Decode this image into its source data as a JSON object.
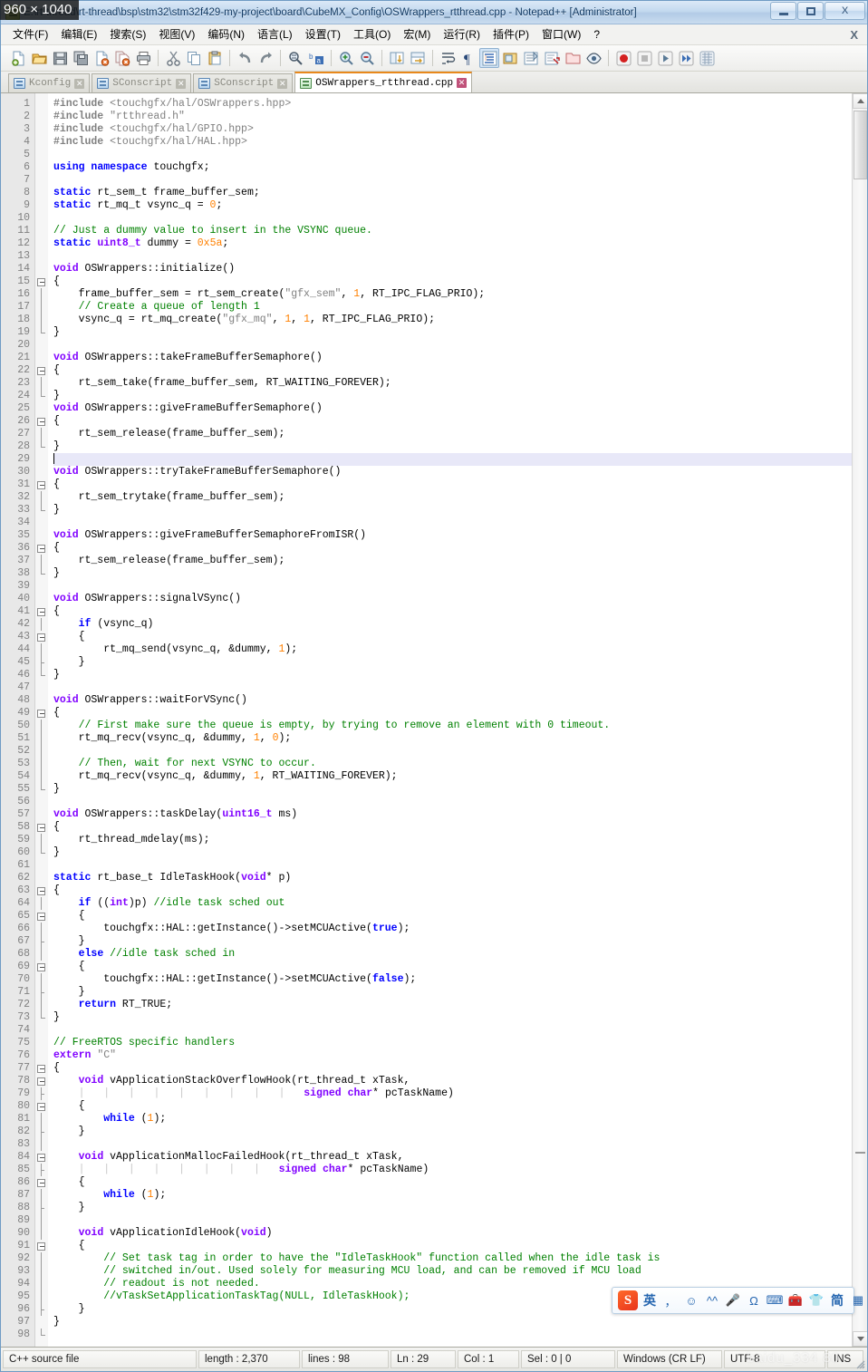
{
  "overlay": {
    "size_badge": "960 × 1040"
  },
  "window": {
    "title": "E:\\rt-thread\\rt-thread\\bsp\\stm32\\stm32f429-my-project\\board\\CubeMX_Config\\OSWrappers_rtthread.cpp - Notepad++ [Administrator]",
    "minimize_label": "Minimize",
    "maximize_label": "Restore",
    "close_label": "X",
    "doc_close_label": "X"
  },
  "menu": {
    "items": [
      "文件(F)",
      "编辑(E)",
      "搜索(S)",
      "视图(V)",
      "编码(N)",
      "语言(L)",
      "设置(T)",
      "工具(O)",
      "宏(M)",
      "运行(R)",
      "插件(P)",
      "窗口(W)",
      "?"
    ]
  },
  "toolbar": {
    "buttons": [
      "new-file",
      "open-file",
      "save-file",
      "save-all",
      "close-file",
      "close-all",
      "print",
      "sep",
      "cut",
      "copy",
      "paste",
      "sep",
      "undo",
      "redo",
      "sep",
      "find",
      "replace",
      "sep",
      "zoom-in",
      "zoom-out",
      "sep",
      "sync-vertical-scroll",
      "sync-horizontal-scroll",
      "sep",
      "word-wrap",
      "show-all-characters",
      "show-indent-guide",
      "user-defined-dialog",
      "show-document-map",
      "function-list",
      "folder-as-workspace",
      "monitoring",
      "sep",
      "macro-record",
      "macro-stop",
      "macro-play",
      "macro-playback-multiple",
      "macro-save"
    ]
  },
  "tabs": [
    {
      "label": "Kconfig",
      "active": false
    },
    {
      "label": "SConscript",
      "active": false
    },
    {
      "label": "SConscript",
      "active": false
    },
    {
      "label": "OSWrappers_rtthread.cpp",
      "active": true
    }
  ],
  "editor": {
    "current_line": 29,
    "total_lines": 98,
    "lines": [
      {
        "n": 1,
        "fold": "none",
        "html": "<span class='pre'>#include</span> <span class='str'>&lt;touchgfx/hal/OSWrappers.hpp&gt;</span>"
      },
      {
        "n": 2,
        "fold": "none",
        "html": "<span class='pre'>#include</span> <span class='str'>\"rtthread.h\"</span>"
      },
      {
        "n": 3,
        "fold": "none",
        "html": "<span class='pre'>#include</span> <span class='str'>&lt;touchgfx/hal/GPIO.hpp&gt;</span>"
      },
      {
        "n": 4,
        "fold": "none",
        "html": "<span class='pre'>#include</span> <span class='str'>&lt;touchgfx/hal/HAL.hpp&gt;</span>"
      },
      {
        "n": 5,
        "fold": "none",
        "html": ""
      },
      {
        "n": 6,
        "fold": "none",
        "html": "<span class='kw'>using</span> <span class='kw'>namespace</span> touchgfx;"
      },
      {
        "n": 7,
        "fold": "none",
        "html": ""
      },
      {
        "n": 8,
        "fold": "none",
        "html": "<span class='kw'>static</span> rt_sem_t frame_buffer_sem;"
      },
      {
        "n": 9,
        "fold": "none",
        "html": "<span class='kw'>static</span> rt_mq_t vsync_q = <span class='num'>0</span>;"
      },
      {
        "n": 10,
        "fold": "none",
        "html": ""
      },
      {
        "n": 11,
        "fold": "none",
        "html": "<span class='cmt'>// Just a dummy value to insert in the VSYNC queue.</span>"
      },
      {
        "n": 12,
        "fold": "none",
        "html": "<span class='kw'>static</span> <span class='typ'>uint8_t</span> dummy = <span class='num'>0x5a</span>;"
      },
      {
        "n": 13,
        "fold": "none",
        "html": ""
      },
      {
        "n": 14,
        "fold": "none",
        "html": "<span class='typ'>void</span> OSWrappers::initialize()"
      },
      {
        "n": 15,
        "fold": "open",
        "html": "{"
      },
      {
        "n": 16,
        "fold": "line",
        "html": "    frame_buffer_sem = rt_sem_create(<span class='str'>\"gfx_sem\"</span>, <span class='num'>1</span>, RT_IPC_FLAG_PRIO);"
      },
      {
        "n": 17,
        "fold": "line",
        "html": "    <span class='cmt'>// Create a queue of length 1</span>"
      },
      {
        "n": 18,
        "fold": "line",
        "html": "    vsync_q = rt_mq_create(<span class='str'>\"gfx_mq\"</span>, <span class='num'>1</span>, <span class='num'>1</span>, RT_IPC_FLAG_PRIO);"
      },
      {
        "n": 19,
        "fold": "end",
        "html": "}"
      },
      {
        "n": 20,
        "fold": "none",
        "html": ""
      },
      {
        "n": 21,
        "fold": "none",
        "html": "<span class='typ'>void</span> OSWrappers::takeFrameBufferSemaphore()"
      },
      {
        "n": 22,
        "fold": "open",
        "html": "{"
      },
      {
        "n": 23,
        "fold": "line",
        "html": "    rt_sem_take(frame_buffer_sem, RT_WAITING_FOREVER);"
      },
      {
        "n": 24,
        "fold": "end",
        "html": "}"
      },
      {
        "n": 25,
        "fold": "none",
        "html": "<span class='typ'>void</span> OSWrappers::giveFrameBufferSemaphore()"
      },
      {
        "n": 26,
        "fold": "open",
        "html": "{"
      },
      {
        "n": 27,
        "fold": "line",
        "html": "    rt_sem_release(frame_buffer_sem);"
      },
      {
        "n": 28,
        "fold": "end",
        "html": "}"
      },
      {
        "n": 29,
        "fold": "none",
        "html": "<span class='caret'></span>",
        "current": true
      },
      {
        "n": 30,
        "fold": "none",
        "html": "<span class='typ'>void</span> OSWrappers::tryTakeFrameBufferSemaphore()"
      },
      {
        "n": 31,
        "fold": "open",
        "html": "{"
      },
      {
        "n": 32,
        "fold": "line",
        "html": "    rt_sem_trytake(frame_buffer_sem);"
      },
      {
        "n": 33,
        "fold": "end",
        "html": "}"
      },
      {
        "n": 34,
        "fold": "none",
        "html": ""
      },
      {
        "n": 35,
        "fold": "none",
        "html": "<span class='typ'>void</span> OSWrappers::giveFrameBufferSemaphoreFromISR()"
      },
      {
        "n": 36,
        "fold": "open",
        "html": "{"
      },
      {
        "n": 37,
        "fold": "line",
        "html": "    rt_sem_release(frame_buffer_sem);"
      },
      {
        "n": 38,
        "fold": "end",
        "html": "}"
      },
      {
        "n": 39,
        "fold": "none",
        "html": ""
      },
      {
        "n": 40,
        "fold": "none",
        "html": "<span class='typ'>void</span> OSWrappers::signalVSync()"
      },
      {
        "n": 41,
        "fold": "open",
        "html": "{"
      },
      {
        "n": 42,
        "fold": "line",
        "html": "    <span class='kw'>if</span> (vsync_q)"
      },
      {
        "n": 43,
        "fold": "open2",
        "html": "    {"
      },
      {
        "n": 44,
        "fold": "line",
        "html": "        rt_mq_send(vsync_q, &amp;dummy, <span class='num'>1</span>);"
      },
      {
        "n": 45,
        "fold": "tick",
        "html": "    }"
      },
      {
        "n": 46,
        "fold": "end",
        "html": "}"
      },
      {
        "n": 47,
        "fold": "none",
        "html": ""
      },
      {
        "n": 48,
        "fold": "none",
        "html": "<span class='typ'>void</span> OSWrappers::waitForVSync()"
      },
      {
        "n": 49,
        "fold": "open",
        "html": "{"
      },
      {
        "n": 50,
        "fold": "line",
        "html": "    <span class='cmt'>// First make sure the queue is empty, by trying to remove an element with 0 timeout.</span>"
      },
      {
        "n": 51,
        "fold": "line",
        "html": "    rt_mq_recv(vsync_q, &amp;dummy, <span class='num'>1</span>, <span class='num'>0</span>);"
      },
      {
        "n": 52,
        "fold": "line",
        "html": ""
      },
      {
        "n": 53,
        "fold": "line",
        "html": "    <span class='cmt'>// Then, wait for next VSYNC to occur.</span>"
      },
      {
        "n": 54,
        "fold": "line",
        "html": "    rt_mq_recv(vsync_q, &amp;dummy, <span class='num'>1</span>, RT_WAITING_FOREVER);"
      },
      {
        "n": 55,
        "fold": "end",
        "html": "}"
      },
      {
        "n": 56,
        "fold": "none",
        "html": ""
      },
      {
        "n": 57,
        "fold": "none",
        "html": "<span class='typ'>void</span> OSWrappers::taskDelay(<span class='typ'>uint16_t</span> ms)"
      },
      {
        "n": 58,
        "fold": "open",
        "html": "{"
      },
      {
        "n": 59,
        "fold": "line",
        "html": "    rt_thread_mdelay(ms);"
      },
      {
        "n": 60,
        "fold": "end",
        "html": "}"
      },
      {
        "n": 61,
        "fold": "none",
        "html": ""
      },
      {
        "n": 62,
        "fold": "none",
        "html": "<span class='kw'>static</span> rt_base_t IdleTaskHook(<span class='typ'>void</span>* p)"
      },
      {
        "n": 63,
        "fold": "open",
        "html": "{"
      },
      {
        "n": 64,
        "fold": "line",
        "html": "    <span class='kw'>if</span> ((<span class='typ'>int</span>)p) <span class='cmt'>//idle task sched out</span>"
      },
      {
        "n": 65,
        "fold": "open2",
        "html": "    {"
      },
      {
        "n": 66,
        "fold": "line",
        "html": "        touchgfx::HAL::getInstance()-&gt;setMCUActive(<span class='kw'>true</span>);"
      },
      {
        "n": 67,
        "fold": "tick",
        "html": "    }"
      },
      {
        "n": 68,
        "fold": "line",
        "html": "    <span class='kw'>else</span> <span class='cmt'>//idle task sched in</span>"
      },
      {
        "n": 69,
        "fold": "open2",
        "html": "    {"
      },
      {
        "n": 70,
        "fold": "line",
        "html": "        touchgfx::HAL::getInstance()-&gt;setMCUActive(<span class='kw'>false</span>);"
      },
      {
        "n": 71,
        "fold": "tick",
        "html": "    }"
      },
      {
        "n": 72,
        "fold": "line",
        "html": "    <span class='kw'>return</span> RT_TRUE;"
      },
      {
        "n": 73,
        "fold": "end",
        "html": "}"
      },
      {
        "n": 74,
        "fold": "none",
        "html": ""
      },
      {
        "n": 75,
        "fold": "none",
        "html": "<span class='cmt'>// FreeRTOS specific handlers</span>"
      },
      {
        "n": 76,
        "fold": "none",
        "html": "<span class='typ'>extern</span> <span class='str'>\"C\"</span>"
      },
      {
        "n": 77,
        "fold": "open",
        "html": "{"
      },
      {
        "n": 78,
        "fold": "open2",
        "html": "    <span class='typ'>void</span> vApplicationStackOverflowHook(rt_thread_t xTask,"
      },
      {
        "n": 79,
        "fold": "tick",
        "html": "    <span class='idg'>|</span>   <span class='idg'>|</span>   <span class='idg'>|</span>   <span class='idg'>|</span>   <span class='idg'>|</span>   <span class='idg'>|</span>   <span class='idg'>|</span>   <span class='idg'>|</span>   <span class='idg'>|</span>   <span class='typ'>signed</span> <span class='typ'>char</span>* pcTaskName)"
      },
      {
        "n": 80,
        "fold": "open2",
        "html": "    {"
      },
      {
        "n": 81,
        "fold": "line",
        "html": "        <span class='kw'>while</span> (<span class='num'>1</span>);"
      },
      {
        "n": 82,
        "fold": "tick",
        "html": "    }"
      },
      {
        "n": 83,
        "fold": "line",
        "html": ""
      },
      {
        "n": 84,
        "fold": "open2",
        "html": "    <span class='typ'>void</span> vApplicationMallocFailedHook(rt_thread_t xTask,"
      },
      {
        "n": 85,
        "fold": "tick",
        "html": "    <span class='idg'>|</span>   <span class='idg'>|</span>   <span class='idg'>|</span>   <span class='idg'>|</span>   <span class='idg'>|</span>   <span class='idg'>|</span>   <span class='idg'>|</span>   <span class='idg'>|</span>   <span class='typ'>signed</span> <span class='typ'>char</span>* pcTaskName)"
      },
      {
        "n": 86,
        "fold": "open2",
        "html": "    {"
      },
      {
        "n": 87,
        "fold": "line",
        "html": "        <span class='kw'>while</span> (<span class='num'>1</span>);"
      },
      {
        "n": 88,
        "fold": "tick",
        "html": "    }"
      },
      {
        "n": 89,
        "fold": "line",
        "html": ""
      },
      {
        "n": 90,
        "fold": "line",
        "html": "    <span class='typ'>void</span> vApplicationIdleHook(<span class='typ'>void</span>)"
      },
      {
        "n": 91,
        "fold": "open2",
        "html": "    {"
      },
      {
        "n": 92,
        "fold": "line",
        "html": "        <span class='cmt'>// Set task tag in order to have the \"IdleTaskHook\" function called when the idle task is</span>"
      },
      {
        "n": 93,
        "fold": "line",
        "html": "        <span class='cmt'>// switched in/out. Used solely for measuring MCU load, and can be removed if MCU load</span>"
      },
      {
        "n": 94,
        "fold": "line",
        "html": "        <span class='cmt'>// readout is not needed.</span>"
      },
      {
        "n": 95,
        "fold": "line",
        "html": "        <span class='cmt'>//vTaskSetApplicationTaskTag(NULL, IdleTaskHook);</span>"
      },
      {
        "n": 96,
        "fold": "tick",
        "html": "    }"
      },
      {
        "n": 97,
        "fold": "none",
        "html": "}"
      },
      {
        "n": 98,
        "fold": "end",
        "html": ""
      }
    ]
  },
  "ime": {
    "logo": "S",
    "items": [
      {
        "name": "language-mode",
        "glyph": "英"
      },
      {
        "name": "punctuation-mode",
        "glyph": "，"
      },
      {
        "name": "emoji",
        "glyph": "☺"
      },
      {
        "name": "expression",
        "glyph": "^^"
      },
      {
        "name": "voice-input",
        "glyph": "🎤"
      },
      {
        "name": "symbol-input",
        "glyph": "Ω"
      },
      {
        "name": "soft-keyboard",
        "glyph": "⌨"
      },
      {
        "name": "toolbox",
        "glyph": "🧰"
      },
      {
        "name": "skin",
        "glyph": "👕"
      },
      {
        "name": "simplified-mode",
        "glyph": "简"
      },
      {
        "name": "app-grid",
        "glyph": "▦"
      }
    ]
  },
  "statusbar": {
    "file_type": "C++ source file",
    "length": "length : 2,370",
    "lines": "lines : 98",
    "ln": "Ln : 29",
    "col": "Col : 1",
    "sel": "Sel : 0 | 0",
    "eol": "Windows (CR LF)",
    "encoding": "UTF-8",
    "insert_mode": "INS",
    "watermark": "baidu_334     80"
  },
  "colors": {
    "accent_tab": "#e8891c",
    "keyword": "#0000ff",
    "type": "#8000ff",
    "comment": "#008000",
    "string": "#808080",
    "number": "#ff8000",
    "current_line": "#e8e8f8"
  }
}
